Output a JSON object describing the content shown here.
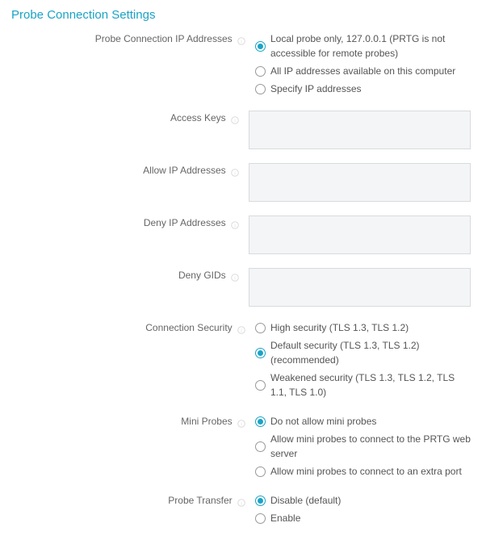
{
  "section_title": "Probe Connection Settings",
  "fields": {
    "probe_ip": {
      "label": "Probe Connection IP Addresses",
      "options": {
        "local": "Local probe only, 127.0.0.1 (PRTG is not accessible for remote probes)",
        "all": "All IP addresses available on this computer",
        "specify": "Specify IP addresses"
      }
    },
    "access_keys": {
      "label": "Access Keys",
      "value": ""
    },
    "allow_ip": {
      "label": "Allow IP Addresses",
      "value": ""
    },
    "deny_ip": {
      "label": "Deny IP Addresses",
      "value": ""
    },
    "deny_gids": {
      "label": "Deny GIDs",
      "value": ""
    },
    "conn_security": {
      "label": "Connection Security",
      "options": {
        "high": "High security (TLS 1.3, TLS 1.2)",
        "default": "Default security (TLS 1.3, TLS 1.2) (recommended)",
        "weak": "Weakened security (TLS 1.3, TLS 1.2, TLS 1.1, TLS 1.0)"
      }
    },
    "mini_probes": {
      "label": "Mini Probes",
      "options": {
        "disallow": "Do not allow mini probes",
        "webserver": "Allow mini probes to connect to the PRTG web server",
        "extra": "Allow mini probes to connect to an extra port"
      }
    },
    "probe_transfer": {
      "label": "Probe Transfer",
      "options": {
        "disable": "Disable (default)",
        "enable": "Enable"
      }
    }
  }
}
